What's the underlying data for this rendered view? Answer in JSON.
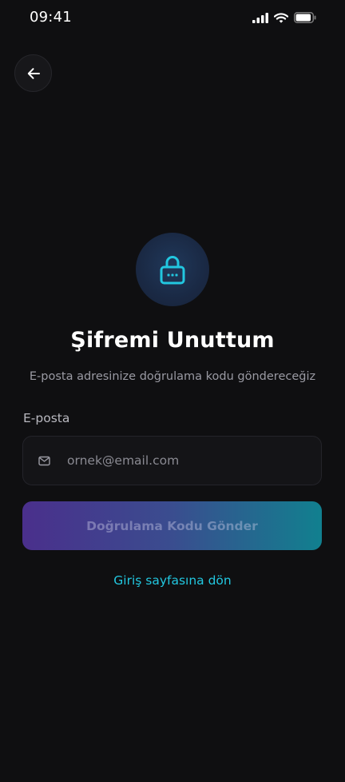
{
  "status_bar": {
    "time": "09:41",
    "icons": [
      "signal-icon",
      "wifi-icon",
      "battery-icon"
    ]
  },
  "header": {
    "back_icon": "arrow-left-icon"
  },
  "hero": {
    "icon": "lock-icon",
    "title": "Şifremi Unuttum",
    "subtitle": "E-posta adresinize doğrulama kodu göndereceğiz"
  },
  "form": {
    "email_label": "E-posta",
    "email_icon": "mail-icon",
    "email_value": "",
    "email_placeholder": "ornek@email.com",
    "submit_label": "Doğrulama Kodu Gönder"
  },
  "footer": {
    "login_link": "Giriş sayfasına dön"
  },
  "colors": {
    "background": "#0f0f11",
    "accent": "#22c7e0",
    "gradient_start": "#4a2f8c",
    "gradient_end": "#11808f"
  }
}
